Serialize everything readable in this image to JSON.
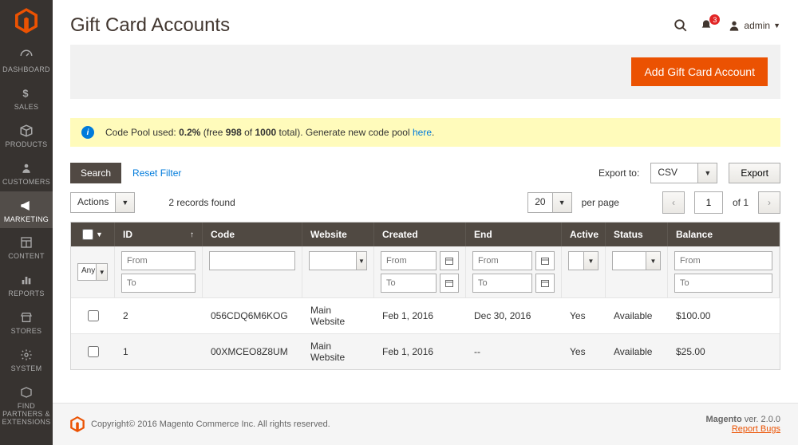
{
  "sidebar": {
    "items": [
      {
        "label": "DASHBOARD"
      },
      {
        "label": "SALES"
      },
      {
        "label": "PRODUCTS"
      },
      {
        "label": "CUSTOMERS"
      },
      {
        "label": "MARKETING"
      },
      {
        "label": "CONTENT"
      },
      {
        "label": "REPORTS"
      },
      {
        "label": "STORES"
      },
      {
        "label": "SYSTEM"
      },
      {
        "label": "FIND PARTNERS & EXTENSIONS"
      }
    ]
  },
  "header": {
    "title": "Gift Card Accounts",
    "badge_count": "3",
    "user_name": "admin"
  },
  "actionbar": {
    "primary_btn": "Add Gift Card Account"
  },
  "notice": {
    "prefix": "Code Pool used: ",
    "pct": "0.2%",
    "free_label": " (free ",
    "free_val": "998",
    "of_label": " of ",
    "total_val": "1000",
    "suffix": " total). Generate new code pool ",
    "link": "here",
    "period": "."
  },
  "toolbar": {
    "search": "Search",
    "reset": "Reset Filter",
    "records": "2 records found",
    "export_label": "Export to:",
    "export_format": "CSV",
    "export_btn": "Export",
    "actions": "Actions",
    "page_size": "20",
    "per_page": "per page",
    "current_page": "1",
    "of_pages": "of 1"
  },
  "columns": {
    "id": "ID",
    "code": "Code",
    "website": "Website",
    "created": "Created",
    "end": "End",
    "active": "Active",
    "status": "Status",
    "balance": "Balance"
  },
  "filters": {
    "any": "Any",
    "from": "From",
    "to": "To"
  },
  "rows": [
    {
      "id": "2",
      "code": "056CDQ6M6KOG",
      "website": "Main Website",
      "created": "Feb 1, 2016",
      "end": "Dec 30, 2016",
      "active": "Yes",
      "status": "Available",
      "balance": "$100.00"
    },
    {
      "id": "1",
      "code": "00XMCEO8Z8UM",
      "website": "Main Website",
      "created": "Feb 1, 2016",
      "end": "--",
      "active": "Yes",
      "status": "Available",
      "balance": "$25.00"
    }
  ],
  "footer": {
    "copyright": "Copyright© 2016 Magento Commerce Inc. All rights reserved.",
    "product": "Magento",
    "version": " ver. 2.0.0",
    "report": "Report Bugs"
  }
}
